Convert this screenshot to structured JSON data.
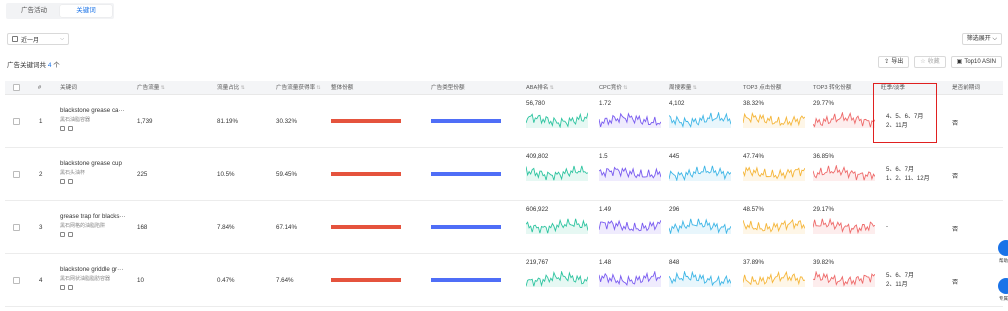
{
  "tabs": [
    {
      "label": "广告活动"
    },
    {
      "label": "关键词"
    }
  ],
  "date_filter": {
    "label": "近一月"
  },
  "filter_button": "筛选展开",
  "summary": {
    "prefix": "广告关键词共",
    "count": "4",
    "suffix": "个"
  },
  "toolbar": {
    "export": "导出",
    "favorite": "收藏",
    "top10": "Top10 ASIN"
  },
  "columns": [
    {
      "label": "#",
      "sortable": false
    },
    {
      "label": "关键词",
      "sortable": false
    },
    {
      "label": "广告流量",
      "sortable": true
    },
    {
      "label": "流量占比",
      "sortable": true
    },
    {
      "label": "广告流量获得率",
      "sortable": true
    },
    {
      "label": "整体份额",
      "sortable": false
    },
    {
      "label": "广告类型份额",
      "sortable": false
    },
    {
      "label": "ABA排名",
      "sortable": true
    },
    {
      "label": "CPC竞价",
      "sortable": true
    },
    {
      "label": "周搜索量",
      "sortable": true
    },
    {
      "label": "TOP3 点击份额",
      "sortable": false
    },
    {
      "label": "TOP3 转化份额",
      "sortable": false
    },
    {
      "label": "旺季/淡季",
      "sortable": false
    },
    {
      "label": "是否前期词",
      "sortable": false
    }
  ],
  "rows": [
    {
      "index": "1",
      "keyword": "blackstone grease ca···",
      "translation": "黑石油脂容器",
      "traffic": "1,739",
      "traffic_share": "81.19%",
      "acquisition": "30.32%",
      "aba": "56,780",
      "cpc": "1.72",
      "weekly_search": "4,102",
      "top3_click": "38.32%",
      "top3_conv": "29.77%",
      "season_line1": "4、5、6、7月",
      "season_line2": "2、11月",
      "early_word": "否"
    },
    {
      "index": "2",
      "keyword": "blackstone grease cup",
      "translation": "黑石头油杯",
      "traffic": "225",
      "traffic_share": "10.5%",
      "acquisition": "59.45%",
      "aba": "409,802",
      "cpc": "1.5",
      "weekly_search": "445",
      "top3_click": "47.74%",
      "top3_conv": "36.85%",
      "season_line1": "5、6、7月",
      "season_line2": "1、2、11、12月",
      "early_word": "否"
    },
    {
      "index": "3",
      "keyword": "grease trap for blacks···",
      "translation": "黑石网格的油脂陷阱",
      "traffic": "168",
      "traffic_share": "7.84%",
      "acquisition": "67.14%",
      "aba": "606,922",
      "cpc": "1.49",
      "weekly_search": "296",
      "top3_click": "48.57%",
      "top3_conv": "29.17%",
      "season_line1": "-",
      "season_line2": "",
      "early_word": "否"
    },
    {
      "index": "4",
      "keyword": "blackstone griddle gr···",
      "translation": "黑石网状油脂脂肪容器",
      "traffic": "10",
      "traffic_share": "0.47%",
      "acquisition": "7.64%",
      "aba": "219,767",
      "cpc": "1.48",
      "weekly_search": "848",
      "top3_click": "37.89%",
      "top3_conv": "39.82%",
      "season_line1": "5、6、7月",
      "season_line2": "2、11月",
      "early_word": "否"
    }
  ],
  "side": {
    "help": "帮助",
    "expert": "专属"
  },
  "colors": {
    "accent": "#1a73e8",
    "overall_share_bar": "#e5533d",
    "ad_type_share_bar": "#4f6ef7",
    "spark_aba": "#2ec4a0",
    "spark_cpc": "#7a5cf0",
    "spark_search": "#3fb6e6",
    "spark_click": "#f5b63a",
    "spark_conv": "#ee6a6a",
    "highlight": "#e02020"
  }
}
